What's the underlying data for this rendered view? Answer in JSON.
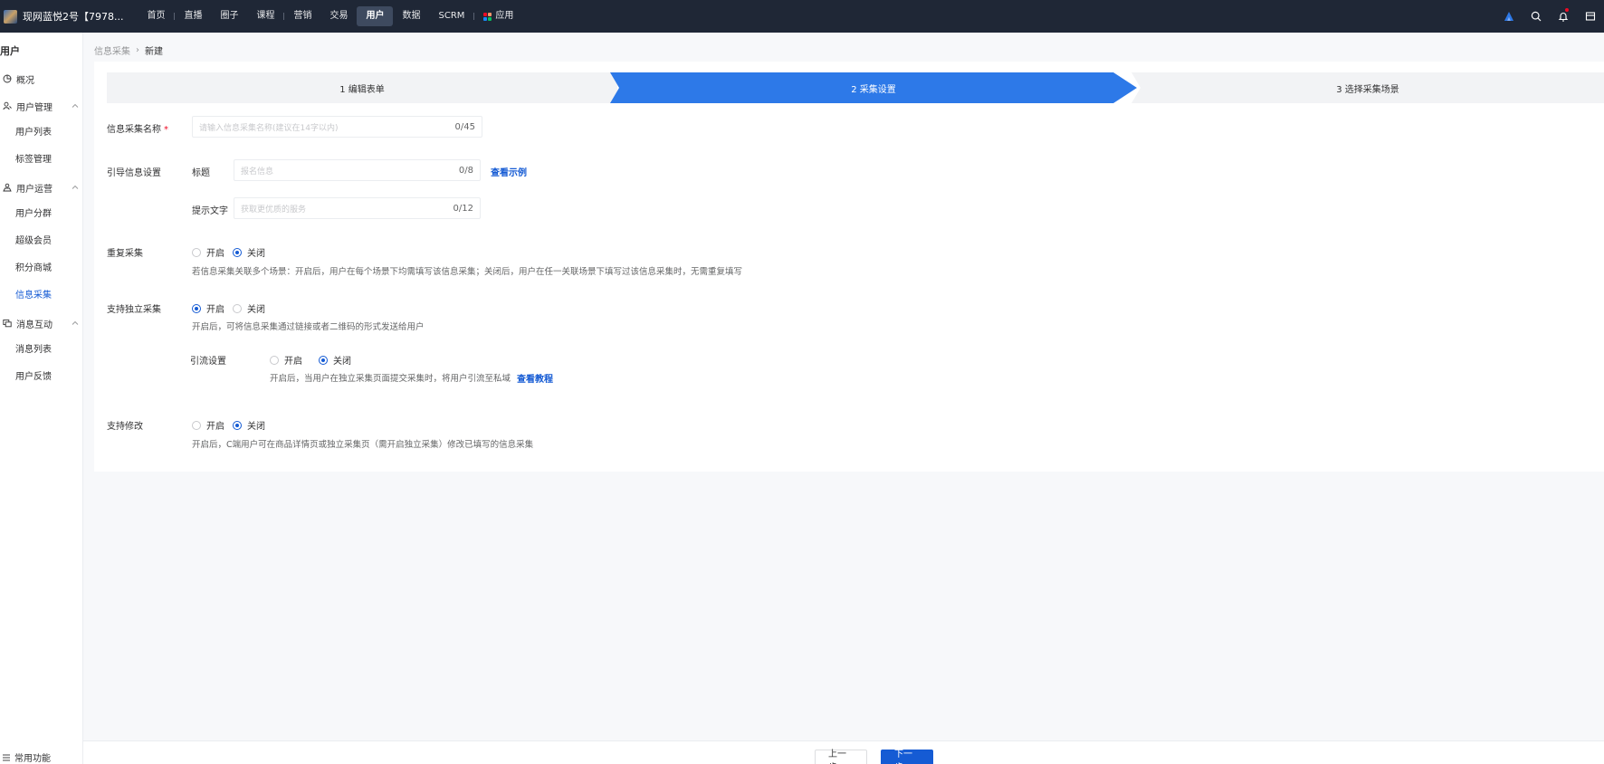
{
  "topbar": {
    "shop_name": "现网蓝悦2号【7978...",
    "nav": [
      "首页",
      "直播",
      "圈子",
      "课程",
      "营销",
      "交易",
      "用户",
      "数据",
      "SCRM"
    ],
    "active_nav": "用户",
    "apps_label": "应用"
  },
  "sidebar": {
    "title": "用户",
    "overview": "概况",
    "groups": [
      {
        "label": "用户管理",
        "items": [
          "用户列表",
          "标签管理"
        ]
      },
      {
        "label": "用户运营",
        "items": [
          "用户分群",
          "超级会员",
          "积分商城",
          "信息采集"
        ]
      },
      {
        "label": "消息互动",
        "items": [
          "消息列表",
          "用户反馈"
        ]
      }
    ],
    "active_item": "信息采集",
    "bottom_label": "常用功能"
  },
  "breadcrumb": {
    "parent": "信息采集",
    "current": "新建"
  },
  "steps": [
    "1 编辑表单",
    "2 采集设置",
    "3 选择采集场景"
  ],
  "form": {
    "name_label": "信息采集名称",
    "name_required": "*",
    "name_placeholder": "请输入信息采集名称(建议在14字以内)",
    "name_count": "0/45",
    "guide_label": "引导信息设置",
    "title_label": "标题",
    "title_placeholder": "报名信息",
    "title_count": "0/8",
    "view_example": "查看示例",
    "tip_label": "提示文字",
    "tip_placeholder": "获取更优质的服务",
    "tip_count": "0/12",
    "repeat_label": "重复采集",
    "on": "开启",
    "off": "关闭",
    "repeat_help": "若信息采集关联多个场景：开启后，用户在每个场景下均需填写该信息采集；关闭后，用户在任一关联场景下填写过该信息采集时，无需重复填写",
    "independent_label": "支持独立采集",
    "independent_help": "开启后，可将信息采集通过链接或者二维码的形式发送给用户",
    "traffic_label": "引流设置",
    "traffic_help": "开启后，当用户在独立采集页面提交采集时，将用户引流至私域",
    "view_tutorial": "查看教程",
    "modify_label": "支持修改",
    "modify_help": "开启后，C端用户可在商品详情页或独立采集页（需开启独立采集）修改已填写的信息采集"
  },
  "footer": {
    "prev": "上一步",
    "next": "下一步"
  }
}
